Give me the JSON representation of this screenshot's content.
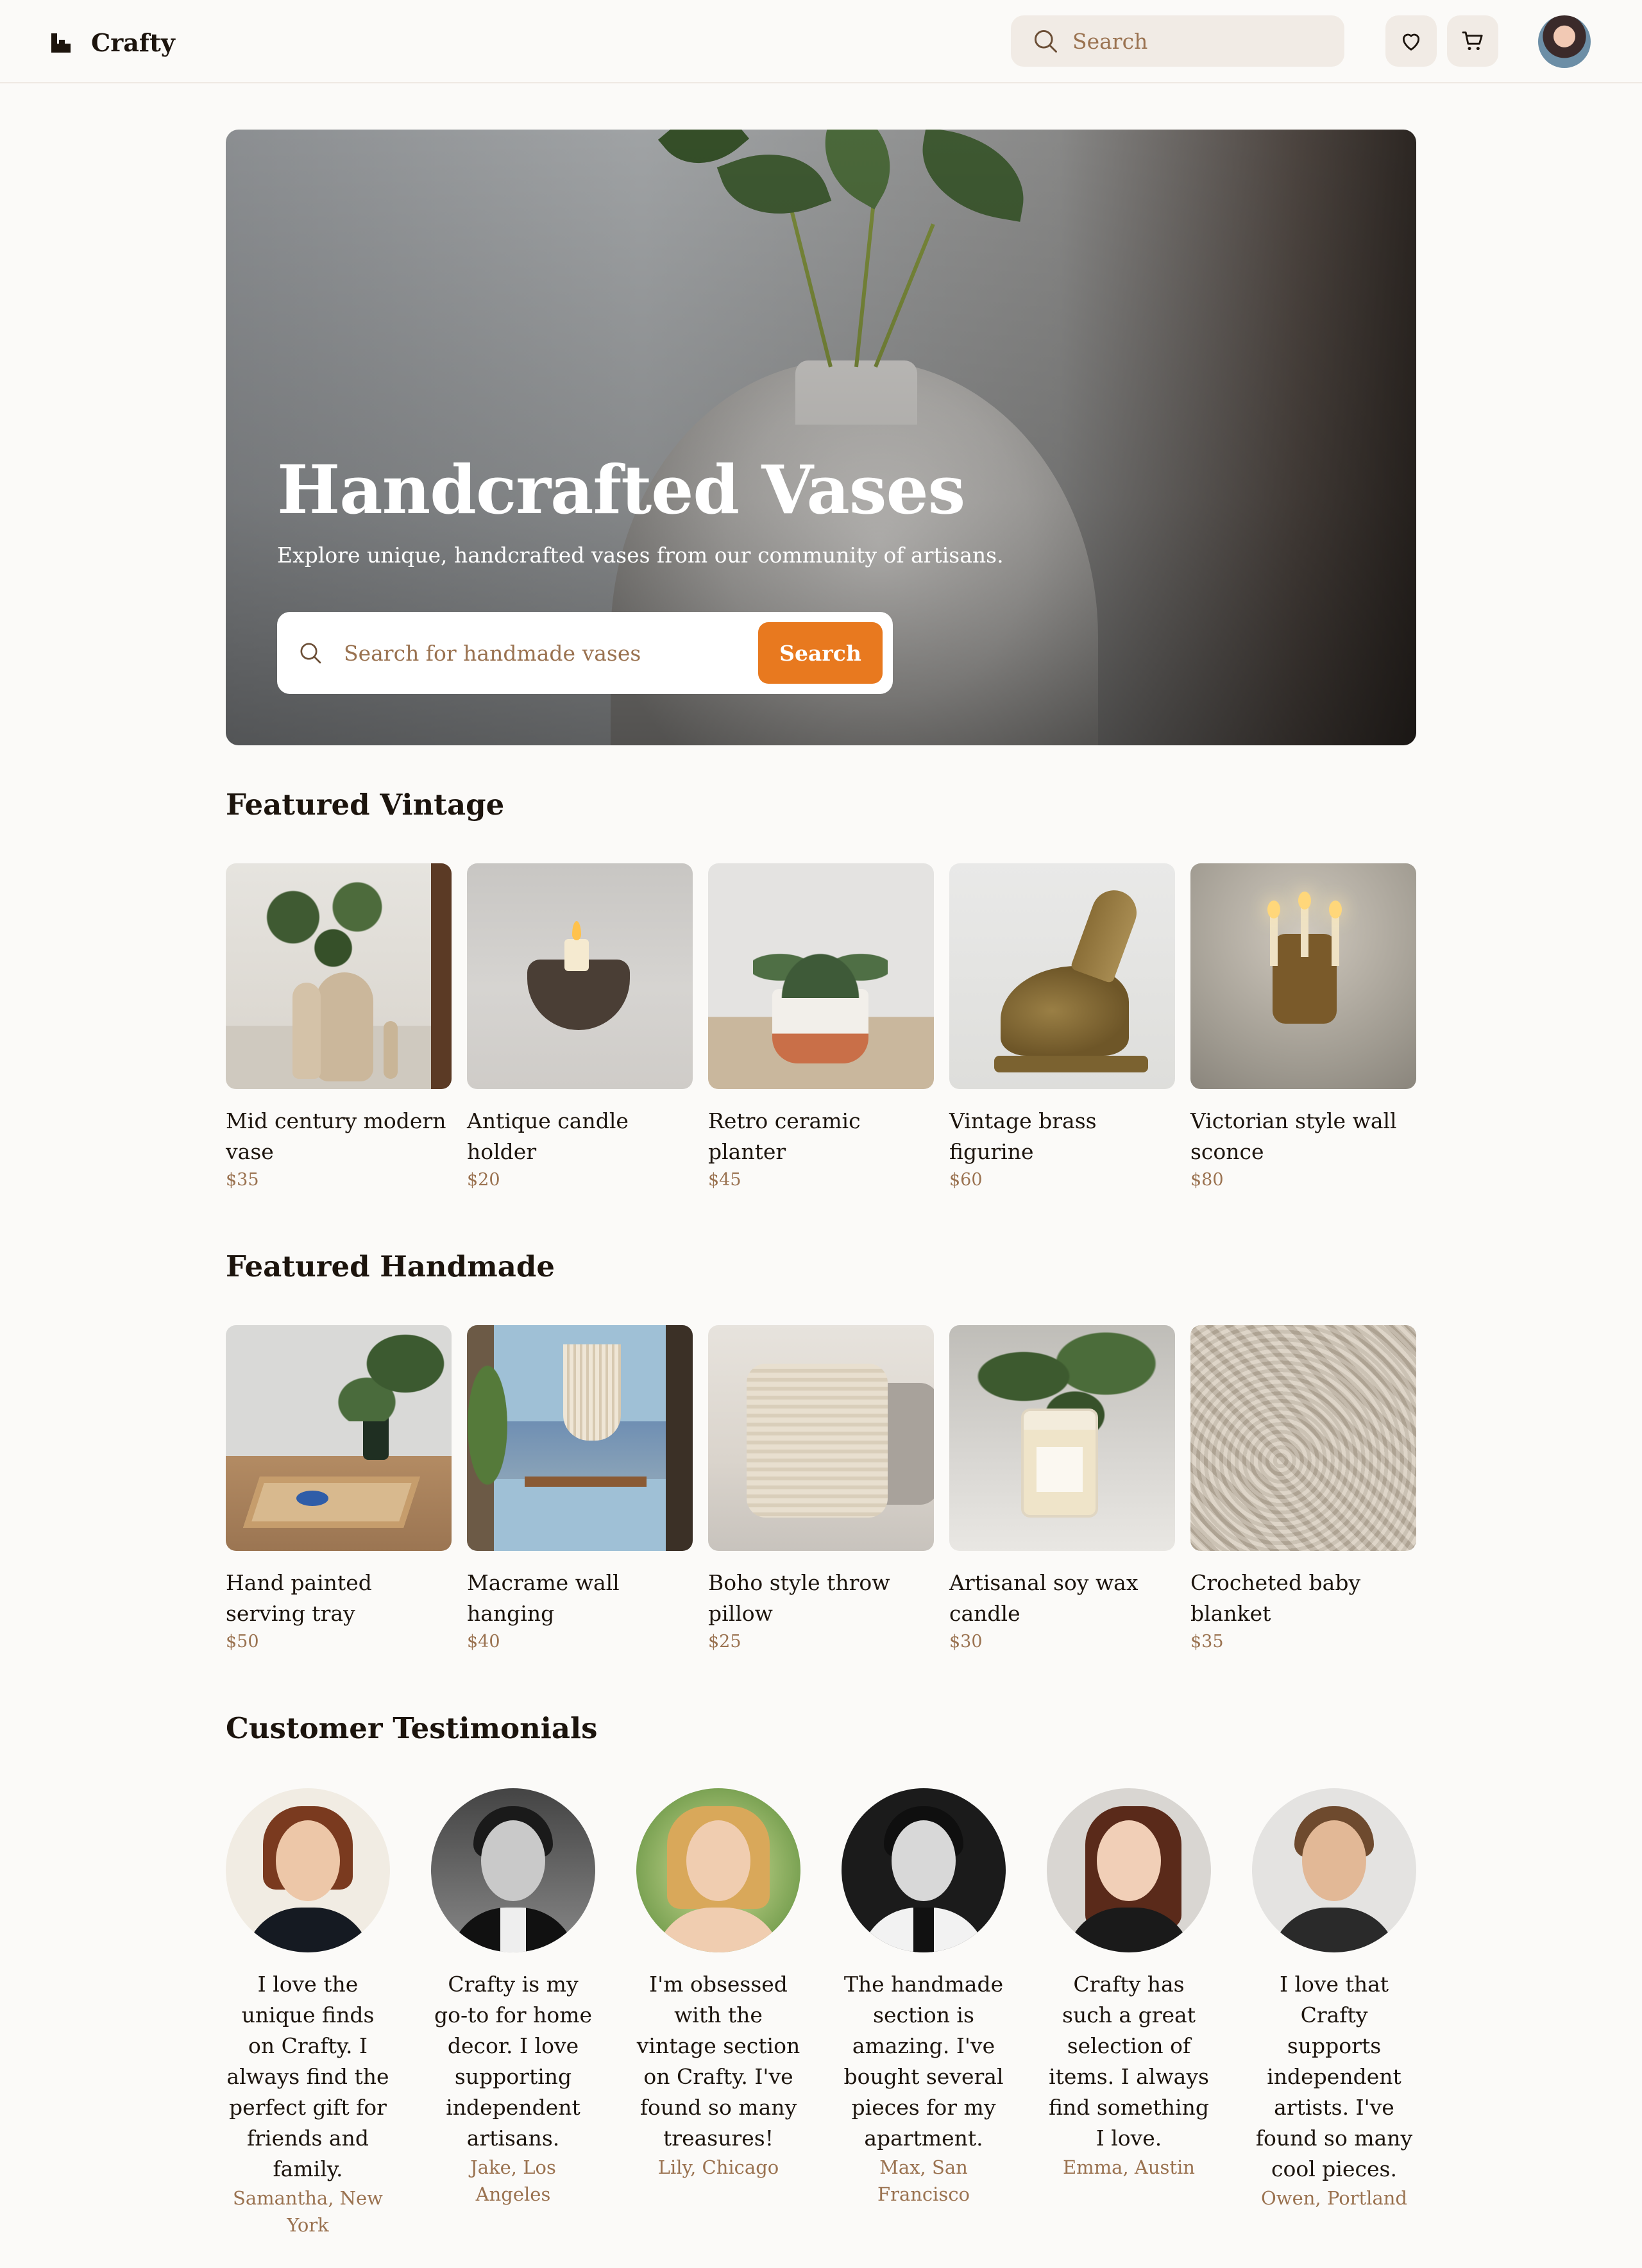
{
  "header": {
    "brand": "Crafty",
    "search_placeholder": "Search",
    "icons": [
      "heart-icon",
      "cart-icon"
    ]
  },
  "hero": {
    "title": "Handcrafted Vases",
    "subtitle": "Explore unique, handcrafted vases from our community of artisans.",
    "search_placeholder": "Search for handmade vases",
    "search_button": "Search",
    "accent": "#e8791f"
  },
  "featured_vintage": {
    "title": "Featured Vintage",
    "items": [
      {
        "name": "Mid century modern vase",
        "price": "$35"
      },
      {
        "name": "Antique candle holder",
        "price": "$20"
      },
      {
        "name": "Retro ceramic planter",
        "price": "$45"
      },
      {
        "name": "Vintage brass figurine",
        "price": "$60"
      },
      {
        "name": "Victorian style wall sconce",
        "price": "$80"
      }
    ]
  },
  "featured_handmade": {
    "title": "Featured Handmade",
    "items": [
      {
        "name": "Hand painted serving tray",
        "price": "$50"
      },
      {
        "name": "Macrame wall hanging",
        "price": "$40"
      },
      {
        "name": "Boho style throw pillow",
        "price": "$25"
      },
      {
        "name": "Artisanal soy wax candle",
        "price": "$30"
      },
      {
        "name": "Crocheted baby blanket",
        "price": "$35"
      }
    ]
  },
  "testimonials": {
    "title": "Customer Testimonials",
    "items": [
      {
        "quote": "I love the unique finds on Crafty. I always find the perfect gift for friends and family.",
        "author": "Samantha, New York"
      },
      {
        "quote": "Crafty is my go-to for home decor. I love supporting independent artisans.",
        "author": "Jake, Los Angeles"
      },
      {
        "quote": "I'm obsessed with the vintage section on Crafty. I've found so many treasures!",
        "author": "Lily, Chicago"
      },
      {
        "quote": "The handmade section is amazing. I've bought several pieces for my apartment.",
        "author": "Max, San Francisco"
      },
      {
        "quote": "Crafty has such a great selection of items. I always find something I love.",
        "author": "Emma, Austin"
      },
      {
        "quote": "I love that Crafty supports independent artists. I've found so many cool pieces.",
        "author": "Owen, Portland"
      }
    ]
  },
  "colors": {
    "background": "#fbfaf8",
    "text": "#1c140d",
    "muted": "#9a7250",
    "chip": "#f1ebe5"
  }
}
